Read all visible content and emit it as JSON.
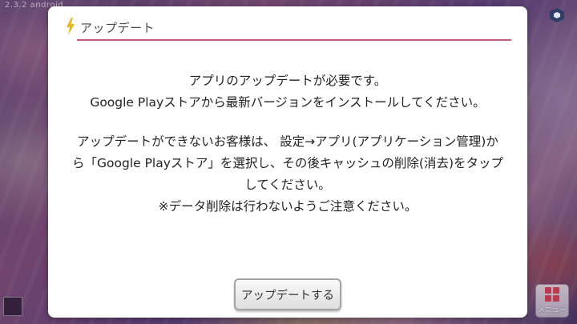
{
  "background": {
    "version_label": "2.3.2 android"
  },
  "dialog": {
    "title": "アップデート",
    "body": [
      "アプリのアップデートが必要です。",
      "Google Playストアから最新バージョンをインストールしてください。",
      "アップデートができないお客様は、 設定→アプリ(アプリケーション管理)から「Google Playストア」を選択し、その後キャッシュの削除(消去)をタップしてください。",
      "※データ削除は行わないようご注意ください。"
    ],
    "button_label": "アップデートする"
  },
  "menu": {
    "label": "メニュー"
  },
  "icons": {
    "header": "lightning-icon",
    "menu": "grid-icon",
    "logo": "chunithm-logo"
  },
  "colors": {
    "accent": "#c85a80",
    "header_icon": "#e6b820",
    "menu_tiles": "#d03a4f"
  }
}
